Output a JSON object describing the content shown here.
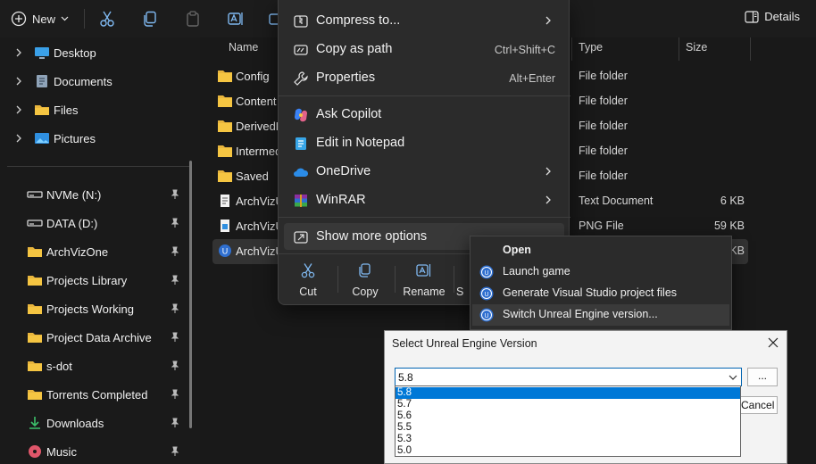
{
  "toolbar": {
    "new_label": "New",
    "details_label": "Details"
  },
  "sidebar": {
    "tree": [
      {
        "label": "Desktop",
        "icon": "desktop-icon"
      },
      {
        "label": "Documents",
        "icon": "documents-icon"
      },
      {
        "label": "Files",
        "icon": "folder-icon"
      },
      {
        "label": "Pictures",
        "icon": "pictures-icon"
      }
    ],
    "quick_access": [
      {
        "label": "NVMe (N:)",
        "icon": "drive-icon"
      },
      {
        "label": "DATA (D:)",
        "icon": "drive-icon"
      },
      {
        "label": "ArchVizOne",
        "icon": "folder-icon"
      },
      {
        "label": "Projects Library",
        "icon": "folder-icon"
      },
      {
        "label": "Projects Working",
        "icon": "folder-icon"
      },
      {
        "label": "Project Data Archive",
        "icon": "folder-icon"
      },
      {
        "label": "s-dot",
        "icon": "folder-icon"
      },
      {
        "label": "Torrents Completed",
        "icon": "folder-icon"
      },
      {
        "label": "Downloads",
        "icon": "download-icon"
      },
      {
        "label": "Music",
        "icon": "music-icon"
      }
    ]
  },
  "columns": {
    "name": "Name",
    "type": "Type",
    "size": "Size"
  },
  "files": [
    {
      "name": "Config",
      "type": "File folder",
      "size": ""
    },
    {
      "name": "Content",
      "type": "File folder",
      "size": ""
    },
    {
      "name": "DerivedD",
      "type": "File folder",
      "size": ""
    },
    {
      "name": "Intermed",
      "type": "File folder",
      "size": ""
    },
    {
      "name": "Saved",
      "type": "File folder",
      "size": ""
    },
    {
      "name": "ArchVizU",
      "type": "Text Document",
      "size": "6 KB"
    },
    {
      "name": "ArchVizU",
      "type": "PNG File",
      "size": "59 KB"
    },
    {
      "name": "ArchVizU",
      "type": "",
      "size": "KB"
    }
  ],
  "context_menu": {
    "items": [
      {
        "label": "Compress to...",
        "shortcut": "",
        "submenu": true
      },
      {
        "label": "Copy as path",
        "shortcut": "Ctrl+Shift+C",
        "submenu": false
      },
      {
        "label": "Properties",
        "shortcut": "Alt+Enter",
        "submenu": false
      },
      {
        "label": "Ask Copilot",
        "shortcut": "",
        "submenu": false
      },
      {
        "label": "Edit in Notepad",
        "shortcut": "",
        "submenu": false
      },
      {
        "label": "OneDrive",
        "shortcut": "",
        "submenu": true
      },
      {
        "label": "WinRAR",
        "shortcut": "",
        "submenu": true
      },
      {
        "label": "Show more options",
        "shortcut": "",
        "submenu": false
      }
    ],
    "bottom": [
      {
        "label": "Cut"
      },
      {
        "label": "Copy"
      },
      {
        "label": "Rename"
      },
      {
        "label": "S"
      }
    ]
  },
  "legacy_menu": {
    "items": [
      {
        "label": "Open",
        "bold": true
      },
      {
        "label": "Launch game"
      },
      {
        "label": "Generate Visual Studio project files"
      },
      {
        "label": "Switch Unreal Engine version..."
      }
    ]
  },
  "dialog": {
    "title": "Select Unreal Engine Version",
    "selected": "5.8",
    "browse_label": "...",
    "cancel_label": "Cancel",
    "options": [
      "5.8",
      "5.7",
      "5.6",
      "5.5",
      "5.3",
      "5.0"
    ]
  },
  "colors": {
    "accent": "#0078d7",
    "folder": "#f5c542",
    "copilot": "#3b82f6",
    "onedrive": "#2b8ce8"
  }
}
